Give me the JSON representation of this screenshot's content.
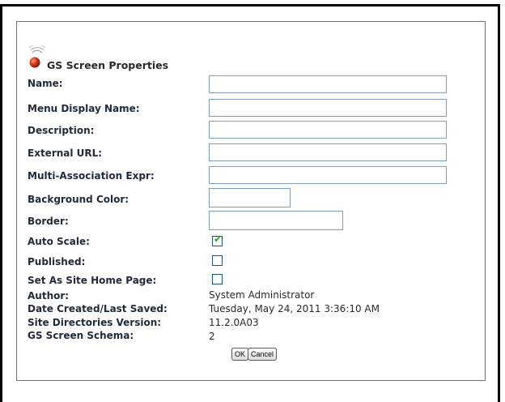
{
  "page": {
    "title": "GS Screen Properties",
    "logo_icon": "broadcast-orb-icon"
  },
  "fields": {
    "name": {
      "label": "Name:",
      "value": ""
    },
    "menu_display_name": {
      "label": "Menu Display Name:",
      "value": ""
    },
    "description": {
      "label": "Description:",
      "value": ""
    },
    "external_url": {
      "label": "External URL:",
      "value": ""
    },
    "multi_association_expr": {
      "label": "Multi-Association Expr:",
      "value": ""
    },
    "background_color": {
      "label": "Background Color:",
      "value": ""
    },
    "border": {
      "label": "Border:",
      "value": ""
    }
  },
  "checkboxes": {
    "auto_scale": {
      "label": "Auto Scale:",
      "checked": true
    },
    "published": {
      "label": "Published:",
      "checked": false
    },
    "site_home_page": {
      "label": "Set As Site Home Page:",
      "checked": false
    }
  },
  "info": {
    "author": {
      "label": "Author:",
      "value": "System Administrator"
    },
    "date_saved": {
      "label": "Date Created/Last Saved:",
      "value": "Tuesday, May 24, 2011 3:36:10 AM"
    },
    "site_dir_version": {
      "label": "Site Directories Version:",
      "value": "11.2.0A03"
    },
    "schema": {
      "label": "GS Screen Schema:",
      "value": "2"
    }
  },
  "buttons": {
    "ok": "OK",
    "cancel": "Cancel"
  },
  "colors": {
    "check": "#21a121",
    "logo": "#d23a1a"
  }
}
